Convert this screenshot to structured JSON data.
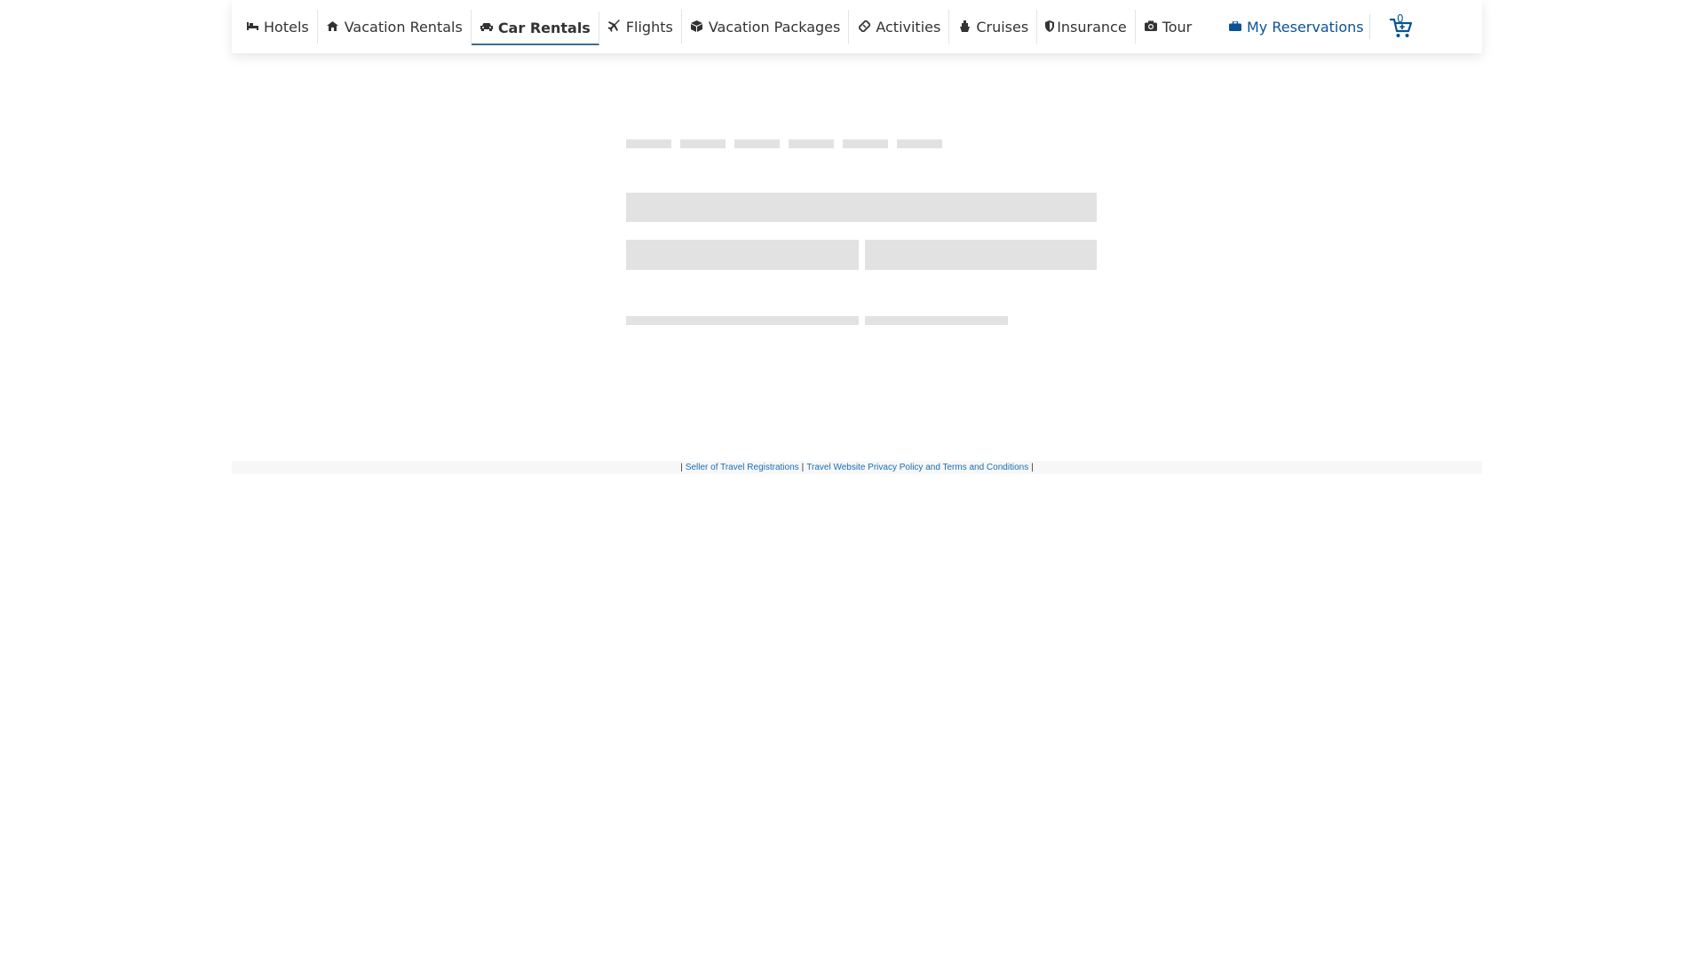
{
  "nav": {
    "items": [
      {
        "label": "Hotels",
        "icon": "bed-icon",
        "glyph": "🛏"
      },
      {
        "label": "Vacation Rentals",
        "icon": "house-icon",
        "glyph": "🏠"
      },
      {
        "label": "Car Rentals",
        "icon": "car-icon",
        "glyph": "🚘",
        "active": true
      },
      {
        "label": "Flights",
        "icon": "plane-icon",
        "glyph": "✈"
      },
      {
        "label": "Vacation Packages",
        "icon": "package-icon",
        "glyph": "📦"
      },
      {
        "label": "Activities",
        "icon": "ticket-icon",
        "glyph": "🎟"
      },
      {
        "label": "Cruises",
        "icon": "ship-icon",
        "glyph": "⛴"
      },
      {
        "label": "Insurance",
        "icon": "shield-icon",
        "glyph": "🛡"
      },
      {
        "label": "Tour",
        "icon": "camera-icon",
        "glyph": "📷"
      }
    ],
    "reservations_label": "My Reservations",
    "reservations_icon": "briefcase-icon",
    "cart_count": "0"
  },
  "footer": {
    "link1": "Seller of Travel Registrations",
    "link2": "Travel Website Privacy Policy and Terms and Conditions",
    "separator": "|"
  },
  "colors": {
    "link_blue": "#0b5394",
    "active_underline": "#3f6e8f",
    "skeleton": "#e2e2e2"
  }
}
